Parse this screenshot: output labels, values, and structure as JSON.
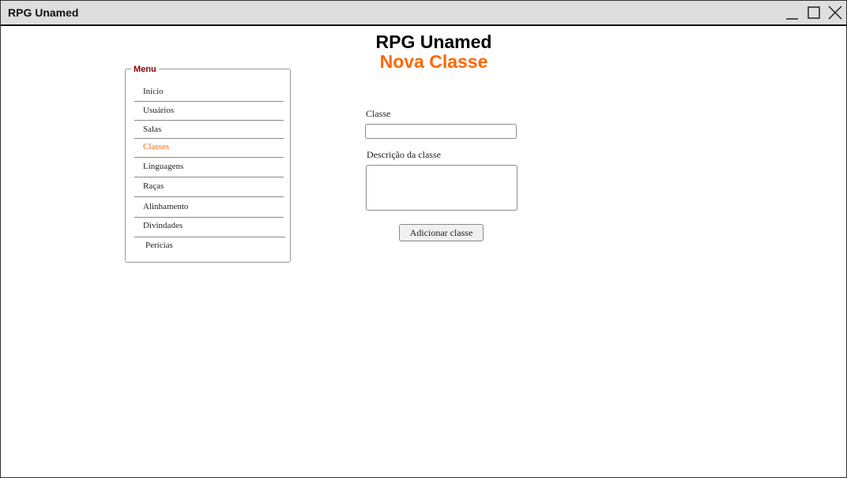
{
  "window": {
    "title": "RPG Unamed"
  },
  "header": {
    "app_title": "RPG Unamed",
    "page_title": "Nova Classe"
  },
  "menu": {
    "legend": "Menu",
    "items": [
      {
        "label": "Início",
        "active": false
      },
      {
        "label": "Usuários",
        "active": false
      },
      {
        "label": "Salas",
        "active": false
      },
      {
        "label": "Classes",
        "active": true
      },
      {
        "label": "Linguagens",
        "active": false
      },
      {
        "label": "Raças",
        "active": false
      },
      {
        "label": "Alinhamento",
        "active": false
      },
      {
        "label": "Divindades",
        "active": false
      },
      {
        "label": "Perícias",
        "active": false
      }
    ]
  },
  "form": {
    "classe_label": "Classe",
    "classe_value": "",
    "descricao_label": "Descrição da classe",
    "descricao_value": "",
    "submit_label": "Adicionar classe"
  },
  "colors": {
    "accent": "#ff6600",
    "legend": "#8b0000",
    "titlebar": "#dedede"
  },
  "icons": [
    "minimize-icon",
    "maximize-icon",
    "close-icon"
  ]
}
